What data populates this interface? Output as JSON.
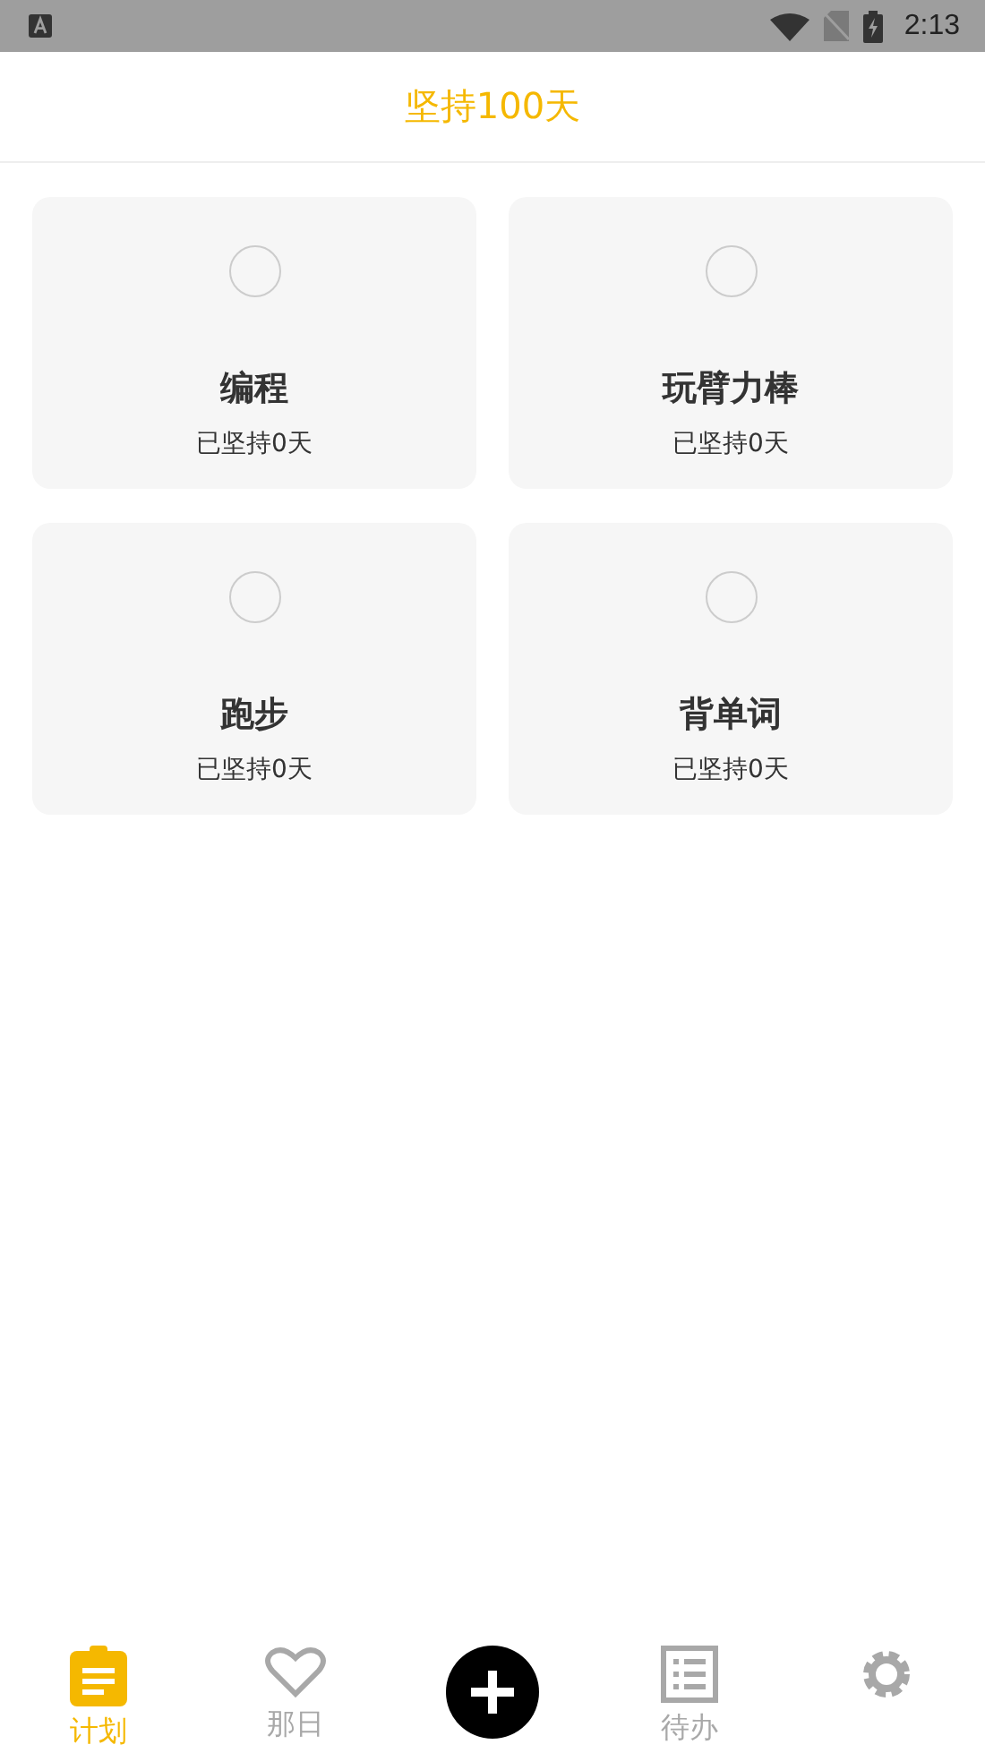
{
  "status_bar": {
    "time": "2:13"
  },
  "header": {
    "title": "坚持100天"
  },
  "plans": [
    {
      "name": "编程",
      "progress": "已坚持0天",
      "checked": false
    },
    {
      "name": "玩臂力棒",
      "progress": "已坚持0天",
      "checked": false
    },
    {
      "name": "跑步",
      "progress": "已坚持0天",
      "checked": false
    },
    {
      "name": "背单词",
      "progress": "已坚持0天",
      "checked": false
    }
  ],
  "tabs": [
    {
      "kind": "clipboard",
      "label": "计划",
      "selected": true
    },
    {
      "kind": "heart",
      "label": "那日",
      "selected": false
    },
    {
      "kind": "add"
    },
    {
      "kind": "list",
      "label": "待办",
      "selected": false
    },
    {
      "kind": "gear",
      "selected": false
    }
  ]
}
